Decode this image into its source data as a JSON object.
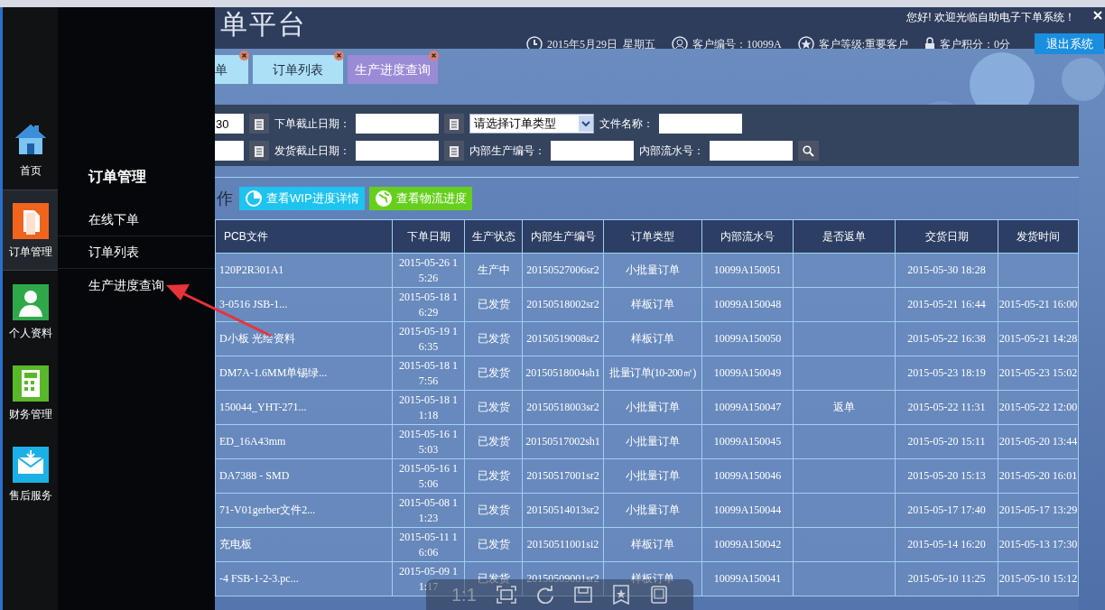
{
  "window": {
    "title": "单平台",
    "welcome": "您好! 欢迎光临自助电子下单系统！"
  },
  "header_info": [
    {
      "kind": "clock",
      "text": "2015年5月29日  星期五"
    },
    {
      "kind": "user",
      "text": "客户编号：10099A"
    },
    {
      "kind": "star",
      "text": "客户等级:重要客户"
    },
    {
      "kind": "lock",
      "text": "客户积分：0分"
    }
  ],
  "logout_button": "退出系统",
  "tabs": [
    {
      "label": "单",
      "selected": false,
      "closable": true
    },
    {
      "label": "订单列表",
      "selected": false,
      "closable": true
    },
    {
      "label": "生产进度查询",
      "selected": true,
      "closable": true
    }
  ],
  "sidebar": {
    "items": [
      {
        "kind": "home",
        "label": "首页",
        "selected": false
      },
      {
        "kind": "document",
        "label": "订单管理",
        "selected": true
      },
      {
        "kind": "person",
        "label": "个人资料",
        "selected": false
      },
      {
        "kind": "calculator",
        "label": "财务管理",
        "selected": false
      },
      {
        "kind": "mail",
        "label": "售后服务",
        "selected": false
      }
    ]
  },
  "flyout": {
    "title": "订单管理",
    "items": [
      {
        "label": "在线下单"
      },
      {
        "label": "订单列表"
      },
      {
        "label": "生产进度查询"
      }
    ]
  },
  "filters": {
    "rows": [
      [
        {
          "kind": "date",
          "value": "30"
        },
        {
          "kind": "date",
          "label": "下单截止日期："
        },
        {
          "kind": "select",
          "value": "请选择订单类型"
        },
        {
          "kind": "text",
          "label": "文件名称："
        }
      ],
      [
        {
          "kind": "date"
        },
        {
          "kind": "date",
          "label": "发货截止日期："
        },
        {
          "kind": "text",
          "label": "内部生产编号："
        },
        {
          "kind": "text",
          "label": "内部流水号："
        },
        {
          "kind": "search"
        }
      ]
    ]
  },
  "list_toolbar": {
    "title": "作",
    "buttons": [
      {
        "kind": "wip",
        "label": "查看WIP进度详情"
      },
      {
        "kind": "logistics",
        "label": "查看物流进度"
      }
    ]
  },
  "table": {
    "columns": [
      "PCB文件",
      "下单日期",
      "生产状态",
      "内部生产编号",
      "订单类型",
      "内部流水号",
      "是否返单",
      "交货日期",
      "发货时间"
    ],
    "rows": [
      {
        "cells": [
          "120P2R301A1",
          "2015-05-26 15:26",
          "生产中",
          "20150527006sr2",
          "小批量订单",
          "10099A150051",
          null,
          "2015-05-30 18:28",
          null
        ]
      },
      {
        "cells": [
          "3-0516 JSB-1...",
          "2015-05-18 16:29",
          "已发货",
          "20150518002sr2",
          "样板订单",
          "10099A150048",
          null,
          "2015-05-21 16:44",
          "2015-05-21 16:00"
        ]
      },
      {
        "cells": [
          "D小板  光绘资料",
          "2015-05-19 16:35",
          "已发货",
          "20150519008sr2",
          "样板订单",
          "10099A150050",
          null,
          "2015-05-22 16:38",
          "2015-05-21 14:28"
        ]
      },
      {
        "cells": [
          "DM7A-1.6MM单锡绿...",
          "2015-05-18 17:56",
          "已发货",
          "20150518004sh1",
          "批量订单(10-200㎡)",
          "10099A150049",
          null,
          "2015-05-23 18:19",
          "2015-05-23 15:02"
        ]
      },
      {
        "cells": [
          "150044_YHT-271...",
          "2015-05-18 11:18",
          "已发货",
          "20150518003sr2",
          "小批量订单",
          "10099A150047",
          "返单",
          "2015-05-22 11:31",
          "2015-05-22 12:00"
        ]
      },
      {
        "cells": [
          "ED_16A43mm",
          "2015-05-16 15:03",
          "已发货",
          "20150517002sh1",
          "小批量订单",
          "10099A150045",
          null,
          "2015-05-20 15:11",
          "2015-05-20 13:44"
        ]
      },
      {
        "cells": [
          "DA7388 - SMD",
          "2015-05-16 15:06",
          "已发货",
          "20150517001sr2",
          "小批量订单",
          "10099A150046",
          null,
          "2015-05-20 15:13",
          "2015-05-20 16:01"
        ]
      },
      {
        "cells": [
          "71-V01gerber文件2...",
          "2015-05-08 11:23",
          "已发货",
          "20150514013sr2",
          "小批量订单",
          "10099A150044",
          null,
          "2015-05-17 17:40",
          "2015-05-17 13:29"
        ]
      },
      {
        "cells": [
          "充电板",
          "2015-05-11 16:06",
          "已发货",
          "20150511001si2",
          "样板订单",
          "10099A150042",
          null,
          "2015-05-14 16:20",
          "2015-05-13 17:30"
        ]
      },
      {
        "cells": [
          "-4 FSB-1-2-3.pc...",
          "2015-05-09 11:17",
          "已发货",
          "20150509001sr2",
          "样板订单",
          "10099A150041",
          null,
          "2015-05-10 11:25",
          "2015-05-10 15:12"
        ]
      }
    ]
  },
  "viewer_toolbar": {
    "zoom_label": "1:1"
  }
}
